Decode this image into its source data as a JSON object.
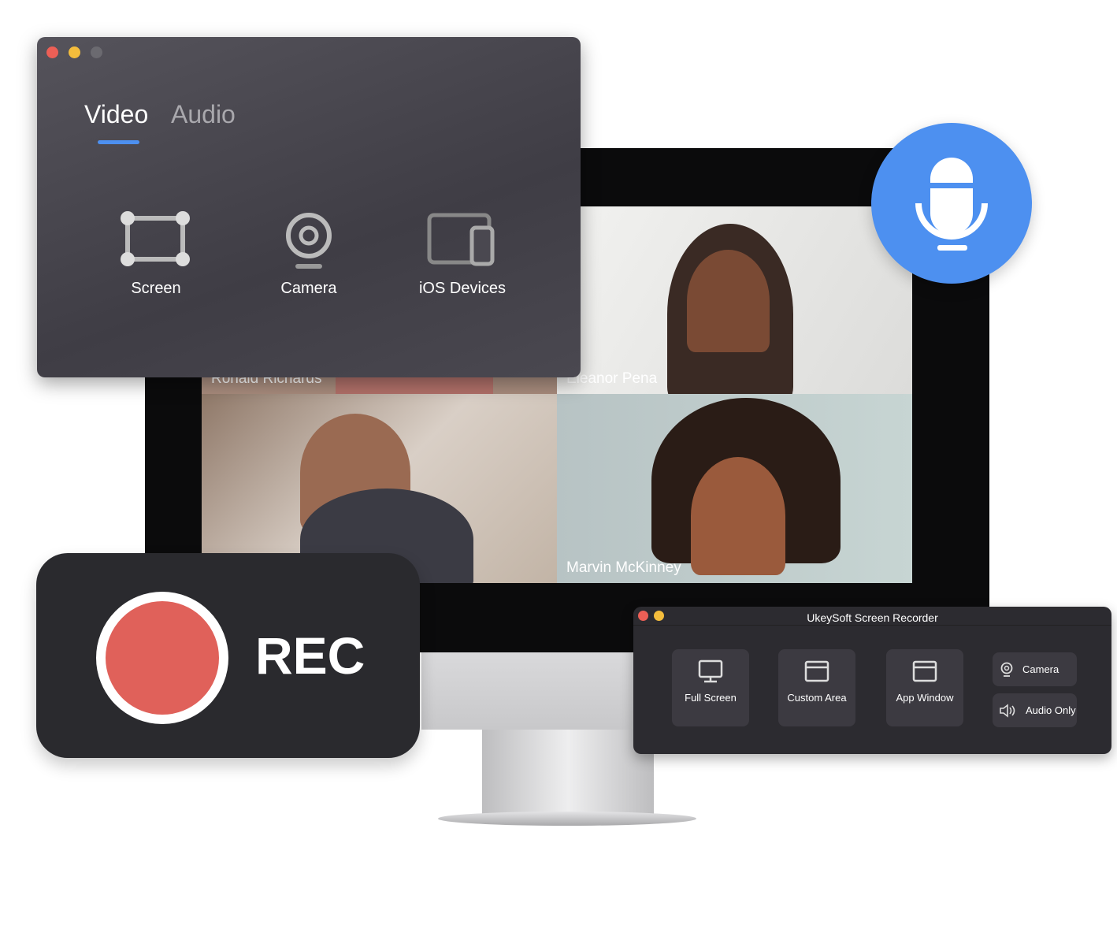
{
  "video_call": {
    "participants": [
      {
        "name": "Ronald Richards"
      },
      {
        "name": "Eleanor Pena"
      },
      {
        "name": ""
      },
      {
        "name": "Marvin McKinney"
      }
    ]
  },
  "source_window": {
    "tabs": [
      {
        "label": "Video",
        "active": true
      },
      {
        "label": "Audio",
        "active": false
      }
    ],
    "sources": [
      {
        "label": "Screen",
        "icon": "screen-region-icon"
      },
      {
        "label": "Camera",
        "icon": "webcam-icon"
      },
      {
        "label": "iOS Devices",
        "icon": "devices-icon"
      }
    ],
    "accent": "#4d90f0"
  },
  "mic_badge": {
    "icon": "microphone-icon",
    "color": "#4d90f0"
  },
  "rec_badge": {
    "label": "REC",
    "color": "#e0615a"
  },
  "recorder_window": {
    "title": "UkeySoft Screen Recorder",
    "modes": [
      {
        "label": "Full Screen",
        "icon": "monitor-icon"
      },
      {
        "label": "Custom Area",
        "icon": "window-icon"
      },
      {
        "label": "App Window",
        "icon": "window-icon"
      }
    ],
    "options": [
      {
        "label": "Camera",
        "icon": "webcam-icon"
      },
      {
        "label": "Audio Only",
        "icon": "speaker-icon"
      }
    ]
  }
}
